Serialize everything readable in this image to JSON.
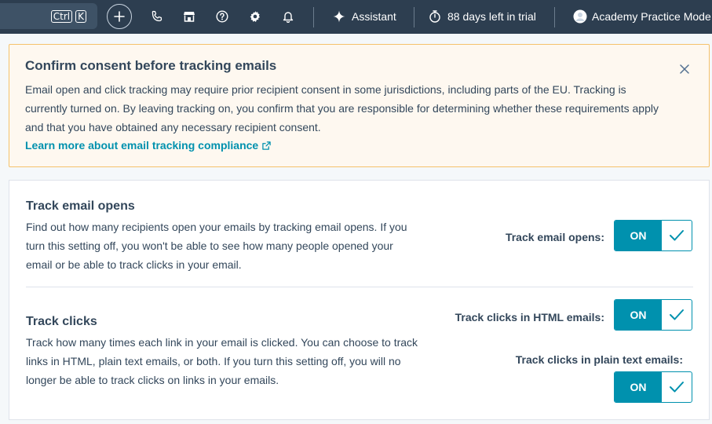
{
  "topnav": {
    "shortcut_keys": [
      "Ctrl",
      "K"
    ],
    "assistant_label": "Assistant",
    "trial_label": "88 days left in trial",
    "account_label": "Academy Practice Mode"
  },
  "banner": {
    "title": "Confirm consent before tracking emails",
    "body": "Email open and click tracking may require prior recipient consent in some jurisdictions, including parts of the EU. Tracking is currently turned on. By leaving tracking on, you confirm that you are responsible for determining whether these requirements apply and that you have obtained any necessary recipient consent.",
    "link": "Learn more about email tracking compliance"
  },
  "opens": {
    "title": "Track email opens",
    "description": "Find out how many recipients open your emails by tracking email opens. If you turn this setting off, you won't be able to see how many people opened your email or be able to track clicks in your email.",
    "label": "Track email opens:",
    "toggle": "ON"
  },
  "clicks": {
    "title": "Track clicks",
    "description": "Track how many times each link in your email is clicked. You can choose to track links in HTML, plain text emails, or both. If you turn this setting off, you will no longer be able to track clicks on links in your emails.",
    "html_label": "Track clicks in HTML emails:",
    "html_toggle": "ON",
    "plain_label": "Track clicks in plain text emails:",
    "plain_toggle": "ON"
  },
  "colors": {
    "nav_bg": "#2d3e50",
    "accent": "#0091ae",
    "banner_bg": "#fef8f0",
    "banner_border": "#f5c26b"
  }
}
